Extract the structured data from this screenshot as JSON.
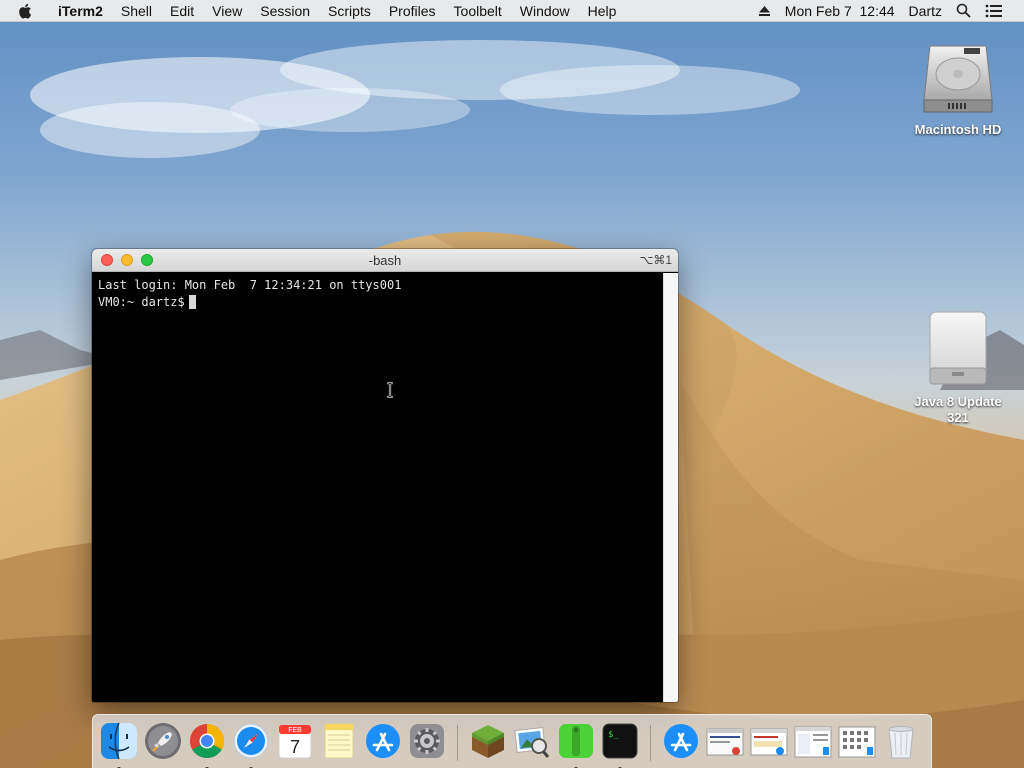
{
  "menubar": {
    "app_name": "iTerm2",
    "items": [
      "Shell",
      "Edit",
      "View",
      "Session",
      "Scripts",
      "Profiles",
      "Toolbelt",
      "Window",
      "Help"
    ],
    "clock": "Mon Feb 7  12:44",
    "user": "Dartz"
  },
  "desktop_icons": {
    "hd_label": "Macintosh HD",
    "java_label_1": "Java 8 Update",
    "java_label_2": "321"
  },
  "terminal": {
    "title": "-bash",
    "shortcut": "⌥⌘1",
    "last_login": "Last login: Mon Feb  7 12:34:21 on ttys001",
    "prompt": "VM0:~ dartz$"
  },
  "dock": {
    "calendar_month": "FEB",
    "calendar_day": "7",
    "terminal_glyph": "$_"
  },
  "colors": {
    "close": "#fc5f57",
    "minimize": "#fdbc2e",
    "zoom": "#28c840",
    "terminal_bg": "#000000"
  }
}
